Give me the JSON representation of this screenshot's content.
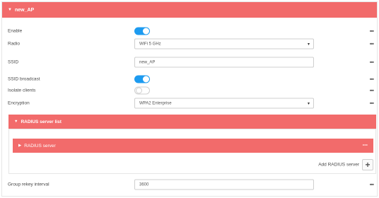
{
  "section": {
    "title": "new_AP",
    "caret_icon": "caret-down-icon"
  },
  "fields": {
    "enable": {
      "label": "Enable",
      "state": "on"
    },
    "radio": {
      "label": "Radio",
      "value": "WiFi 5 GHz"
    },
    "ssid": {
      "label": "SSID",
      "value": "new_AP"
    },
    "ssid_broadcast": {
      "label": "SSID broadcast",
      "state": "on"
    },
    "isolate_clients": {
      "label": "Isolate clients",
      "state": "off"
    },
    "encryption": {
      "label": "Encryption",
      "value": "WPA2 Enterprise"
    },
    "group_rekey": {
      "label": "Group rekey interval",
      "value": "3600"
    }
  },
  "radius_auth": {
    "title": "RADIUS server list",
    "radius_server_title": "RADIUS server",
    "add_label": "Add RADIUS server"
  },
  "menu_icon": "more-dots-icon",
  "colors": {
    "accent": "#f26b6b",
    "toggle_on": "#1d9bf0"
  }
}
